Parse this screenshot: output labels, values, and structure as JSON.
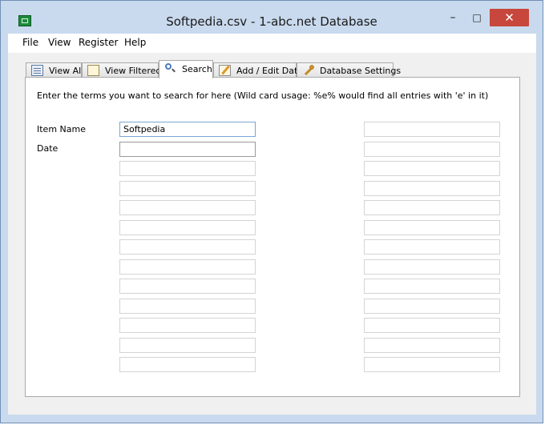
{
  "window": {
    "title": "Softpedia.csv - 1-abc.net Database",
    "controls": {
      "minimize": "–",
      "maximize": "□",
      "close": "✕"
    }
  },
  "menu": [
    "File",
    "View",
    "Register",
    "Help"
  ],
  "tabs": [
    {
      "label": "View All",
      "icon": "table-icon"
    },
    {
      "label": "View Filtered",
      "icon": "filter-icon"
    },
    {
      "label": "Search",
      "icon": "magnifier-icon",
      "active": true
    },
    {
      "label": "Add / Edit Data",
      "icon": "edit-icon"
    },
    {
      "label": "Database Settings",
      "icon": "wrench-icon"
    }
  ],
  "search": {
    "instructions": "Enter the terms you want to search for here (Wild card usage: %e% would find all entries with 'e' in it)",
    "fields": [
      {
        "label": "Item Name",
        "value": "Softpedia"
      },
      {
        "label": "Date",
        "value": ""
      },
      {
        "label": "",
        "value": ""
      },
      {
        "label": "",
        "value": ""
      },
      {
        "label": "",
        "value": ""
      },
      {
        "label": "",
        "value": ""
      },
      {
        "label": "",
        "value": ""
      },
      {
        "label": "",
        "value": ""
      },
      {
        "label": "",
        "value": ""
      },
      {
        "label": "",
        "value": ""
      },
      {
        "label": "",
        "value": ""
      },
      {
        "label": "",
        "value": ""
      },
      {
        "label": "",
        "value": ""
      }
    ],
    "right_fields": [
      "",
      "",
      "",
      "",
      "",
      "",
      "",
      "",
      "",
      "",
      "",
      "",
      ""
    ]
  },
  "colors": {
    "titlebar": "#c9daee",
    "close_button": "#c7473c",
    "active_field_border": "#7aa6d4"
  }
}
